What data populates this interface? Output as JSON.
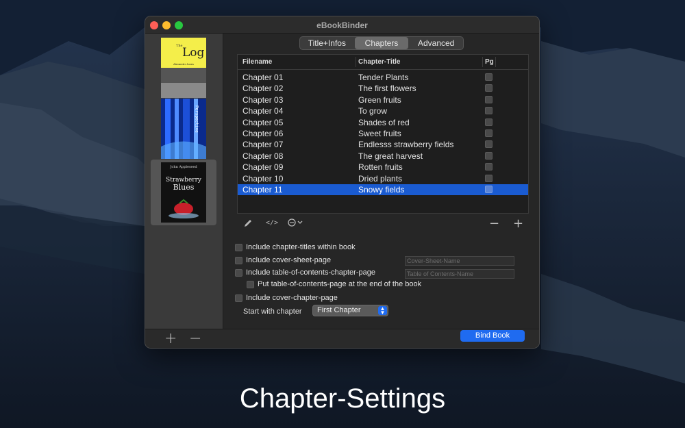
{
  "window": {
    "title": "eBookBinder"
  },
  "sidebar": {
    "covers": [
      {
        "title": "Log",
        "author": "Alexander Jones"
      },
      {
        "title": "Perspective"
      },
      {
        "title": "Strawberry Blues",
        "author": "John Appleseed"
      }
    ],
    "selected_index": 2
  },
  "tabs": [
    {
      "label": "Title+Infos",
      "active": false
    },
    {
      "label": "Chapters",
      "active": true
    },
    {
      "label": "Advanced",
      "active": false
    }
  ],
  "table": {
    "columns": [
      "Filename",
      "Chapter-Title",
      "Pg"
    ],
    "rows": [
      {
        "filename": "Chapter 01",
        "title": "Tender Plants"
      },
      {
        "filename": "Chapter 02",
        "title": "The first flowers"
      },
      {
        "filename": "Chapter 03",
        "title": "Green fruits"
      },
      {
        "filename": "Chapter 04",
        "title": "To grow"
      },
      {
        "filename": "Chapter 05",
        "title": "Shades of red"
      },
      {
        "filename": "Chapter 06",
        "title": "Sweet fruits"
      },
      {
        "filename": "Chapter 07",
        "title": "Endlesss strawberry fields"
      },
      {
        "filename": "Chapter 08",
        "title": "The great harvest"
      },
      {
        "filename": "Chapter 09",
        "title": "Rotten fruits"
      },
      {
        "filename": "Chapter 10",
        "title": "Dried plants"
      },
      {
        "filename": "Chapter 11",
        "title": "Snowy fields"
      }
    ],
    "selected_index": 10
  },
  "table_toolbar": {
    "minus": "−",
    "plus": "+"
  },
  "options": {
    "include_titles": "Include chapter-titles within book",
    "include_cover_sheet": "Include cover-sheet-page",
    "cover_sheet_placeholder": "Cover-Sheet-Name",
    "include_toc": "Include table-of-contents-chapter-page",
    "toc_placeholder": "Table of Contents-Name",
    "toc_at_end": "Put table-of-contents-page at the end of the book",
    "include_cover_chapter": "Include cover-chapter-page",
    "start_label": "Start with chapter",
    "start_value": "First Chapter"
  },
  "sidebar_controls": {
    "add": "+",
    "remove": "−"
  },
  "bind_button": "Bind Book",
  "caption": "Chapter-Settings",
  "colors": {
    "accent": "#1f6bf0",
    "selection": "#1a5bd1"
  }
}
